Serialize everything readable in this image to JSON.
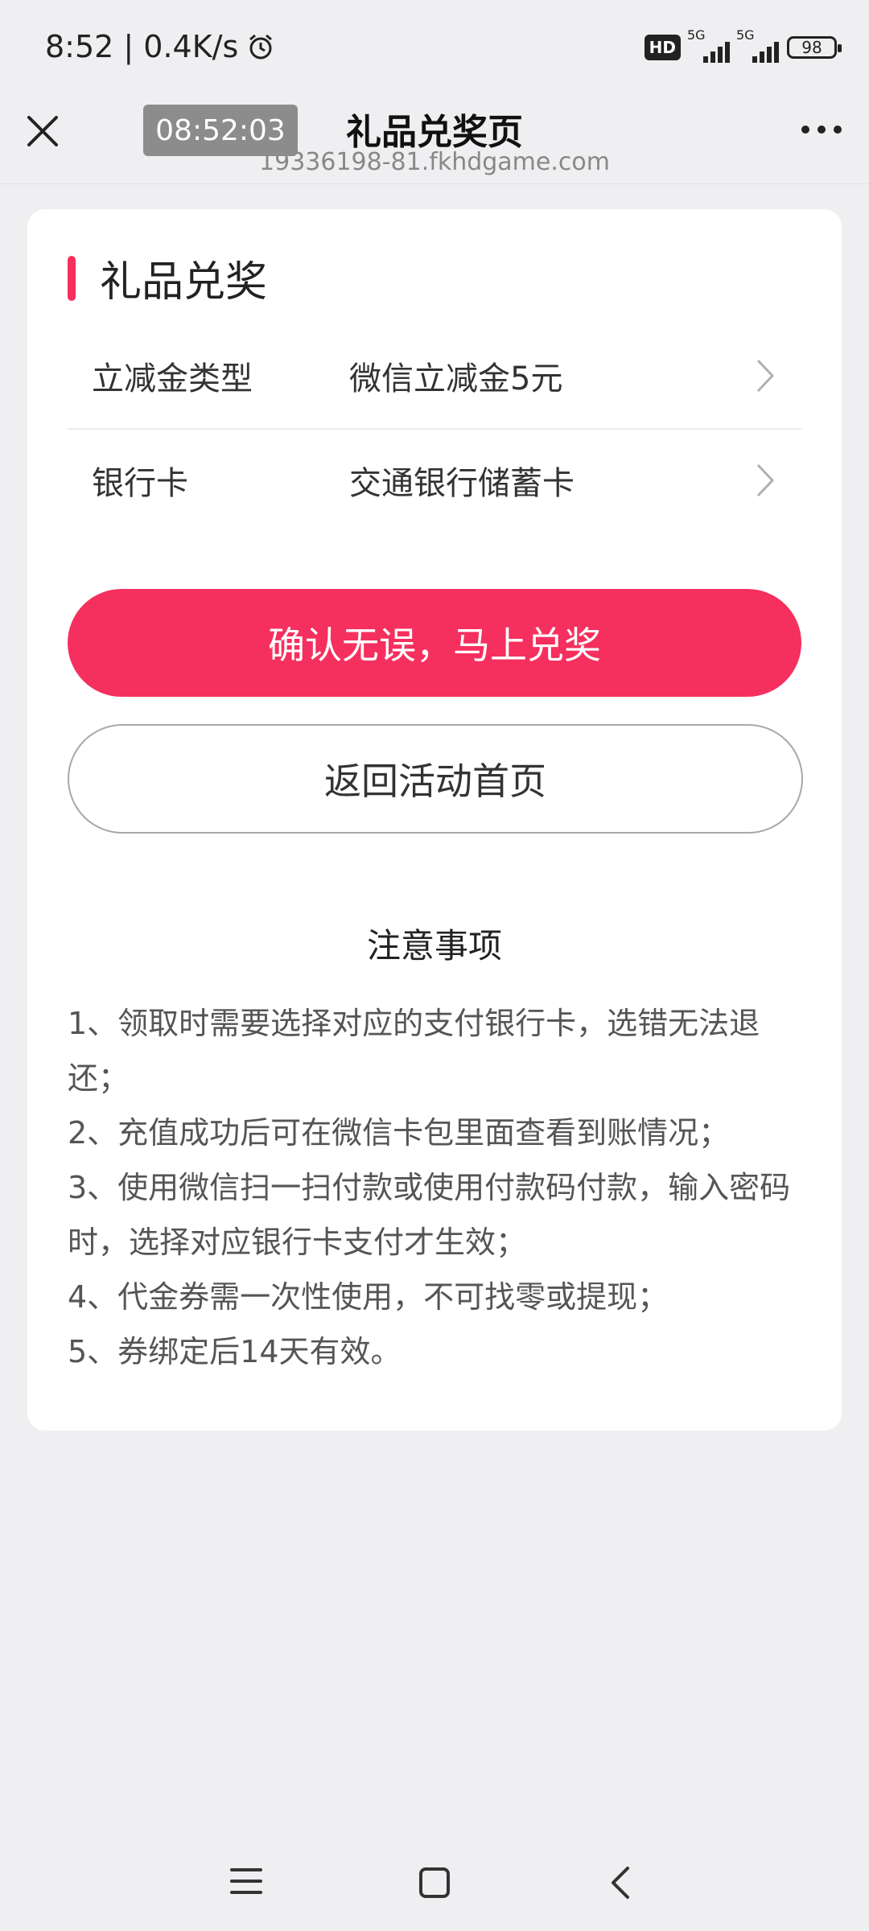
{
  "status_bar": {
    "time_speed": "8:52 | 0.4K/s",
    "network_hd": "HD",
    "signal1_label": "5G",
    "signal2_label": "5G",
    "battery": "98"
  },
  "nav": {
    "timer": "08:52:03",
    "title": "礼品兑奖页",
    "url": "19336198-81.fkhdgame.com"
  },
  "card": {
    "section_title": "礼品兑奖",
    "rows": [
      {
        "label": "立减金类型",
        "value": "微信立减金5元"
      },
      {
        "label": "银行卡",
        "value": "交通银行储蓄卡"
      }
    ],
    "confirm_button": "确认无误，马上兑奖",
    "back_button": "返回活动首页",
    "notes_title": "注意事项",
    "notes": [
      "1、领取时需要选择对应的支付银行卡，选错无法退还；",
      "2、充值成功后可在微信卡包里面查看到账情况；",
      "3、使用微信扫一扫付款或使用付款码付款，输入密码时，选择对应银行卡支付才生效；",
      "4、代金券需一次性使用，不可找零或提现；",
      "5、券绑定后14天有效。"
    ]
  },
  "colors": {
    "accent": "#f5305e",
    "background": "#efeff1"
  }
}
